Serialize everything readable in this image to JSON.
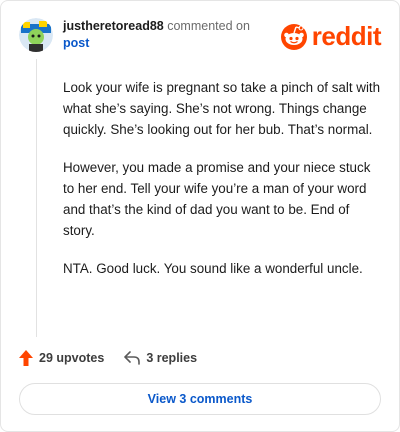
{
  "header": {
    "username": "justheretoread88",
    "commented_text": "commented on",
    "post_link": "post"
  },
  "logo": {
    "word": "reddit",
    "icon": "reddit-alien-icon",
    "color": "#ff4500"
  },
  "comment": {
    "paragraphs": [
      "Look your wife is pregnant so take a pinch of salt with what she’s saying. She’s not wrong. Things change quickly. She’s looking out for her bub. That’s normal.",
      "However, you made a promise and your niece stuck to her end. Tell your wife you’re a man of your word and that’s the kind of dad you want to be. End of story.",
      "NTA. Good luck. You sound like a wonderful uncle."
    ]
  },
  "actions": {
    "upvotes": "29 upvotes",
    "replies": "3 replies",
    "upvote_icon": "upvote-arrow-icon",
    "reply_icon": "reply-arrow-icon",
    "upvote_color": "#ff4500"
  },
  "view_comments": "View 3 comments",
  "colors": {
    "link": "#0a58ca",
    "brand": "#ff4500"
  }
}
